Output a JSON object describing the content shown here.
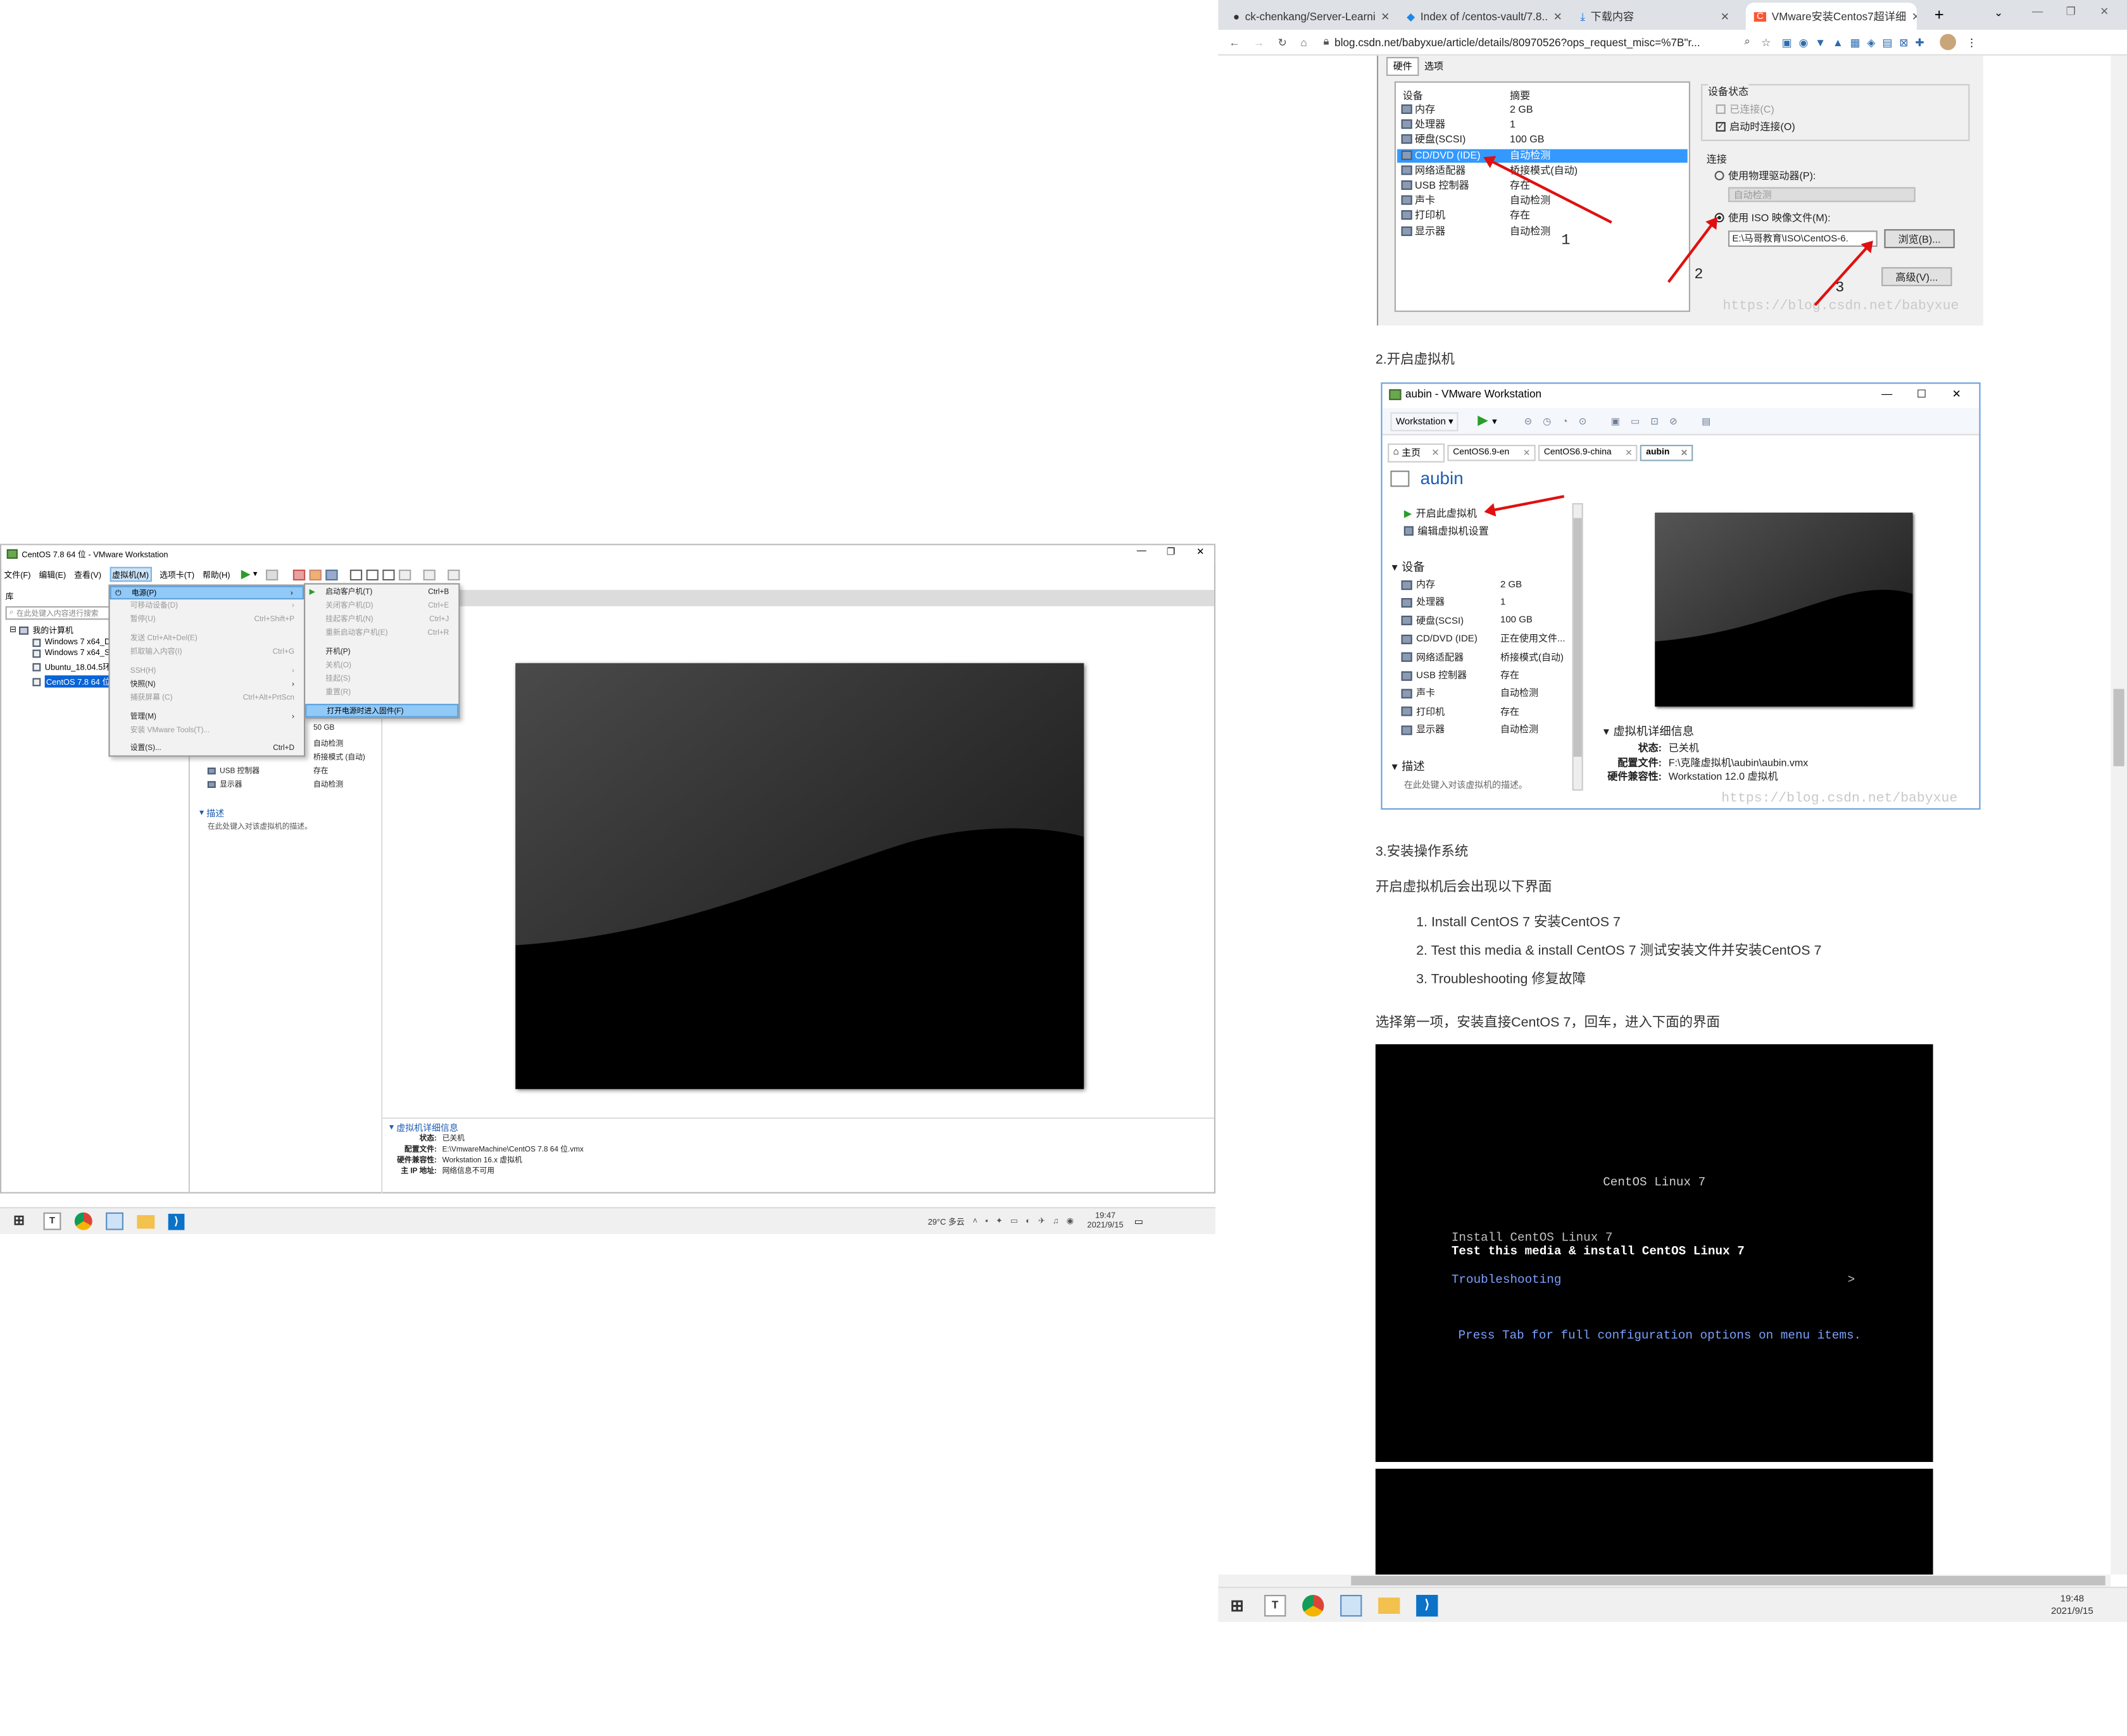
{
  "vmware": {
    "title": "CentOS 7.8 64 位 - VMware Workstation",
    "menubar": [
      "文件(F)",
      "编辑(E)",
      "查看(V)",
      "虚拟机(M)",
      "选项卡(T)",
      "帮助(H)"
    ],
    "library_label": "库",
    "search_placeholder": "在此处键入内容进行搜索",
    "tree_root": "我的计算机",
    "tree_items": [
      "Windows 7 x64_D",
      "Windows 7 x64_S",
      "Ubuntu_18.04.5环",
      "CentOS 7.8 64 位"
    ],
    "vm_menu": [
      {
        "label": "电源(P)",
        "key": "",
        "state": "sel"
      },
      {
        "label": "可移动设备(D)",
        "key": "",
        "state": "dis"
      },
      {
        "label": "暂停(U)",
        "key": "Ctrl+Shift+P",
        "state": "dis"
      },
      {
        "label": "发送 Ctrl+Alt+Del(E)",
        "key": "",
        "state": "dis"
      },
      {
        "label": "抓取输入内容(I)",
        "key": "Ctrl+G",
        "state": "dis"
      },
      {
        "label": "SSH(H)",
        "key": "",
        "state": "dis"
      },
      {
        "label": "快照(N)",
        "key": "",
        "state": ""
      },
      {
        "label": "捕获屏幕 (C)",
        "key": "Ctrl+Alt+PrtScn",
        "state": "dis"
      },
      {
        "label": "管理(M)",
        "key": "",
        "state": ""
      },
      {
        "label": "安装 VMware Tools(T)...",
        "key": "",
        "state": "dis"
      },
      {
        "label": "设置(S)...",
        "key": "Ctrl+D",
        "state": ""
      }
    ],
    "power_menu": [
      {
        "label": "启动客户机(T)",
        "key": "Ctrl+B",
        "state": ""
      },
      {
        "label": "关闭客户机(D)",
        "key": "Ctrl+E",
        "state": "dis"
      },
      {
        "label": "挂起客户机(N)",
        "key": "Ctrl+J",
        "state": "dis"
      },
      {
        "label": "重新启动客户机(E)",
        "key": "Ctrl+R",
        "state": "dis"
      },
      {
        "label": "开机(P)",
        "key": "",
        "state": ""
      },
      {
        "label": "关机(O)",
        "key": "",
        "state": "dis"
      },
      {
        "label": "挂起(S)",
        "key": "",
        "state": "dis"
      },
      {
        "label": "重置(R)",
        "key": "",
        "state": "dis"
      },
      {
        "label": "打开电源时进入固件(F)",
        "key": "",
        "state": "sel"
      }
    ],
    "devices": [
      {
        "name": "",
        "value": "50 GB"
      },
      {
        "name": "",
        "value": "自动检测"
      },
      {
        "name": "",
        "value": "桥接模式 (自动)"
      },
      {
        "name": "USB 控制器",
        "value": "存在"
      },
      {
        "name": "显示器",
        "value": "自动检测"
      }
    ],
    "desc_title": "描述",
    "desc_text": "在此处键入对该虚拟机的描述。",
    "details_title": "虚拟机详细信息",
    "details": [
      {
        "k": "状态:",
        "v": "已关机"
      },
      {
        "k": "配置文件:",
        "v": "E:\\VmwareMachine\\CentOS 7.8 64 位.vmx"
      },
      {
        "k": "硬件兼容性:",
        "v": "Workstation 16.x 虚拟机"
      },
      {
        "k": "主 IP 地址:",
        "v": "网络信息不可用"
      }
    ]
  },
  "taskbar_left": {
    "weather": "29°C 多云",
    "time": "19:47",
    "date": "2021/9/15"
  },
  "browser": {
    "tabs": [
      {
        "title": "ck-chenkang/Server-Learni"
      },
      {
        "title": "Index of /centos-vault/7.8.."
      },
      {
        "title": "下载内容"
      },
      {
        "title": "VMware安装Centos7超详细"
      }
    ],
    "url": "blog.csdn.net/babyxue/article/details/80970526?ops_request_misc=%7B\"r..."
  },
  "article": {
    "shot1": {
      "tabs": [
        "硬件",
        "选项"
      ],
      "col_device": "设备",
      "col_summary": "摘要",
      "rows": [
        {
          "d": "内存",
          "s": "2 GB"
        },
        {
          "d": "处理器",
          "s": "1"
        },
        {
          "d": "硬盘(SCSI)",
          "s": "100 GB"
        },
        {
          "d": "CD/DVD (IDE)",
          "s": "自动检测"
        },
        {
          "d": "网络适配器",
          "s": "桥接模式(自动)"
        },
        {
          "d": "USB 控制器",
          "s": "存在"
        },
        {
          "d": "声卡",
          "s": "自动检测"
        },
        {
          "d": "打印机",
          "s": "存在"
        },
        {
          "d": "显示器",
          "s": "自动检测"
        }
      ],
      "device_status": "设备状态",
      "connected": "已连接(C)",
      "connect_on_power": "启动时连接(O)",
      "connection": "连接",
      "use_physical": "使用物理驱动器(P):",
      "auto_detect": "自动检测",
      "use_iso": "使用 ISO 映像文件(M):",
      "iso_path": "E:\\马哥教育\\ISO\\CentOS-6.",
      "browse": "浏览(B)...",
      "advanced": "高级(V)...",
      "n1": "1",
      "n2": "2",
      "n3": "3",
      "watermark": "https://blog.csdn.net/babyxue"
    },
    "h2": "2.开启虚拟机",
    "shot2": {
      "title": "aubin - VMware Workstation",
      "menu": "Workstation",
      "tabs": [
        "主页",
        "CentOS6.9-en",
        "CentOS6.9-china",
        "aubin"
      ],
      "vm_name": "aubin",
      "power_on": "开启此虚拟机",
      "edit_settings": "编辑虚拟机设置",
      "devices_title": "设备",
      "devices": [
        {
          "d": "内存",
          "s": "2 GB"
        },
        {
          "d": "处理器",
          "s": "1"
        },
        {
          "d": "硬盘(SCSI)",
          "s": "100 GB"
        },
        {
          "d": "CD/DVD (IDE)",
          "s": "正在使用文件..."
        },
        {
          "d": "网络适配器",
          "s": "桥接模式(自动)"
        },
        {
          "d": "USB 控制器",
          "s": "存在"
        },
        {
          "d": "声卡",
          "s": "自动检测"
        },
        {
          "d": "打印机",
          "s": "存在"
        },
        {
          "d": "显示器",
          "s": "自动检测"
        }
      ],
      "desc_title": "描述",
      "desc_text": "在此处键入对该虚拟机的描述。",
      "details_title": "虚拟机详细信息",
      "details": [
        {
          "k": "状态:",
          "v": "已关机"
        },
        {
          "k": "配置文件:",
          "v": "F:\\克隆虚拟机\\aubin\\aubin.vmx"
        },
        {
          "k": "硬件兼容性:",
          "v": "Workstation 12.0 虚拟机"
        }
      ],
      "watermark": "https://blog.csdn.net/babyxue"
    },
    "h3": "3.安装操作系统",
    "p1": "开启虚拟机后会出现以下界面",
    "list": [
      "1. Install CentOS 7 安装CentOS 7",
      "2. Test this media & install CentOS 7 测试安装文件并安装CentOS 7",
      "3. Troubleshooting 修复故障"
    ],
    "p2": "选择第一项，安装直接CentOS 7，回车，进入下面的界面",
    "boot": {
      "title": "CentOS Linux 7",
      "opt1": "Install CentOS Linux 7",
      "opt2": "Test this media & install CentOS Linux 7",
      "opt3": "Troubleshooting",
      "chev": ">",
      "hint": "Press Tab for full configuration options on menu items."
    }
  },
  "taskbar_right": {
    "time": "19:48",
    "date": "2021/9/15"
  },
  "colors": {
    "menu_select": "#91c9f7",
    "link_blue": "#1e5cb3",
    "arrow_red": "#e01010",
    "taskbar": "#f0f0f0"
  }
}
